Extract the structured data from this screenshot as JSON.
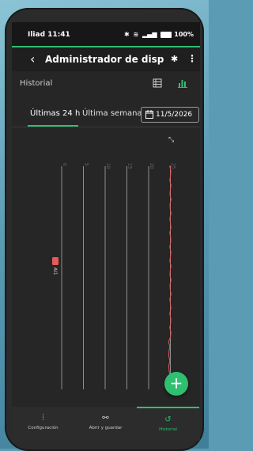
{
  "status": {
    "carrier": "Iliad 11:41",
    "battery": "100%"
  },
  "appbar": {
    "back_icon": "chevron-left-icon",
    "title": "Administrador de disposi...",
    "bt_icon": "bluetooth-icon",
    "more_icon": "more-vert-icon"
  },
  "section": {
    "label": "Historial"
  },
  "tabs": {
    "last24": "Últimas 24 h",
    "lastweek": "Última semana",
    "date": "11/5/2026"
  },
  "chart_data": {
    "type": "line",
    "x_ticks": [
      "0",
      "5",
      "10",
      "15",
      "20",
      "25"
    ],
    "series": [
      {
        "name": "AI1",
        "color": "#e85a5a"
      }
    ],
    "y_unit_label": ""
  },
  "fab": {
    "label": "+"
  },
  "bottom_nav": [
    {
      "label": "Configuración",
      "icon": "sliders-icon"
    },
    {
      "label": "Abrir y guardar",
      "icon": "link-icon"
    },
    {
      "label": "Historial",
      "icon": "history-icon"
    }
  ],
  "colors": {
    "accent": "#2fbf71",
    "series": "#e85a5a"
  }
}
